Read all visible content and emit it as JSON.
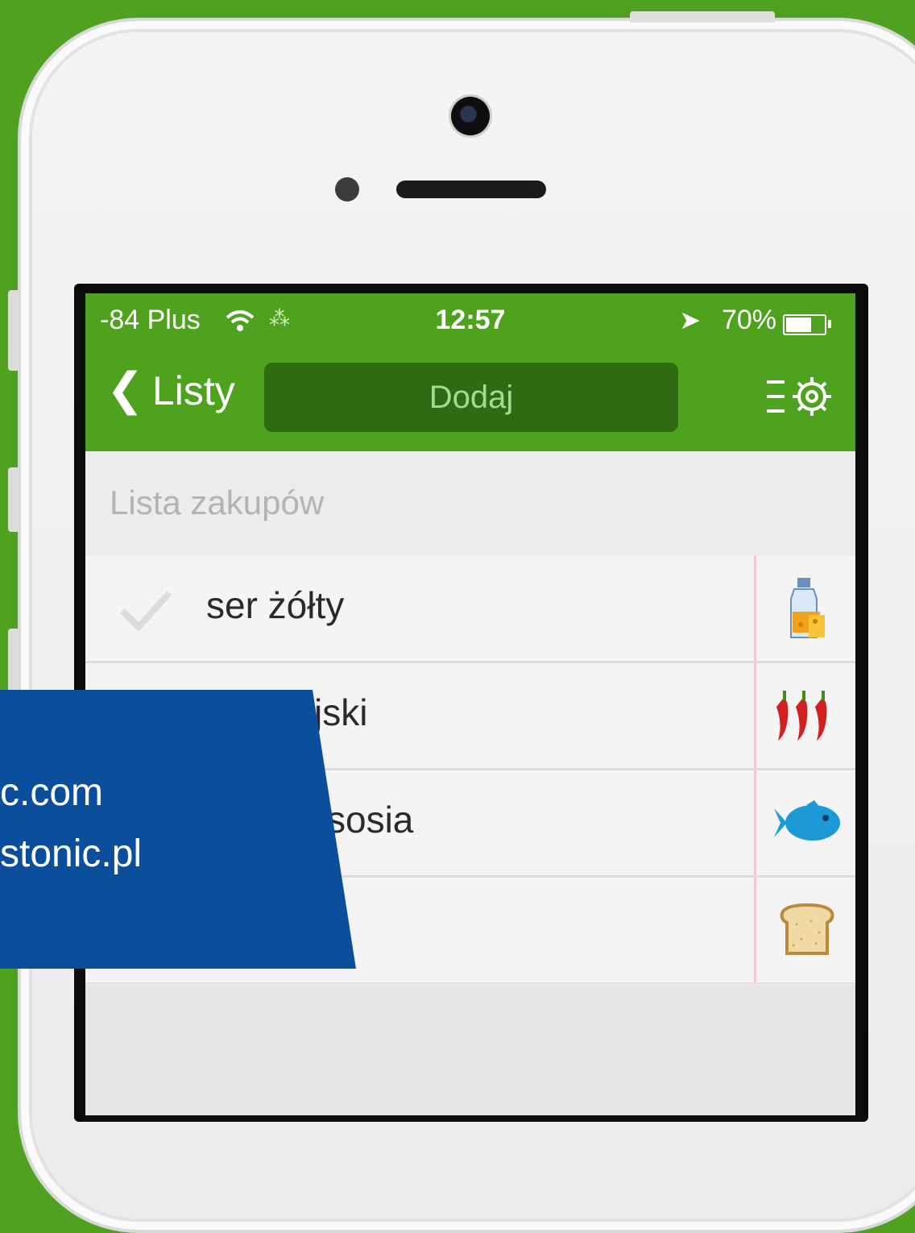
{
  "status_bar": {
    "carrier": "-84 Plus",
    "time": "12:57",
    "battery_percent": "70%",
    "battery_level": 0.7
  },
  "nav": {
    "back_label": "Listy",
    "add_label": "Dodaj",
    "menu_icon": "list-settings-icon"
  },
  "list": {
    "title": "Lista zakupów",
    "items": [
      {
        "label": "ser żółty",
        "icon": "milk-cheese-icon"
      },
      {
        "label": "jski",
        "icon": "chili-pepper-icon"
      },
      {
        "label": "sosia",
        "icon": "fish-icon"
      },
      {
        "label": "",
        "icon": "bread-icon"
      }
    ]
  },
  "banner": {
    "line1": "c.com",
    "line2": "stonic.pl"
  },
  "colors": {
    "background": "#4fa11f",
    "nav_green": "#4ea21d",
    "button_dark_green": "#2f6b12",
    "banner_blue": "#0b4f9c"
  }
}
